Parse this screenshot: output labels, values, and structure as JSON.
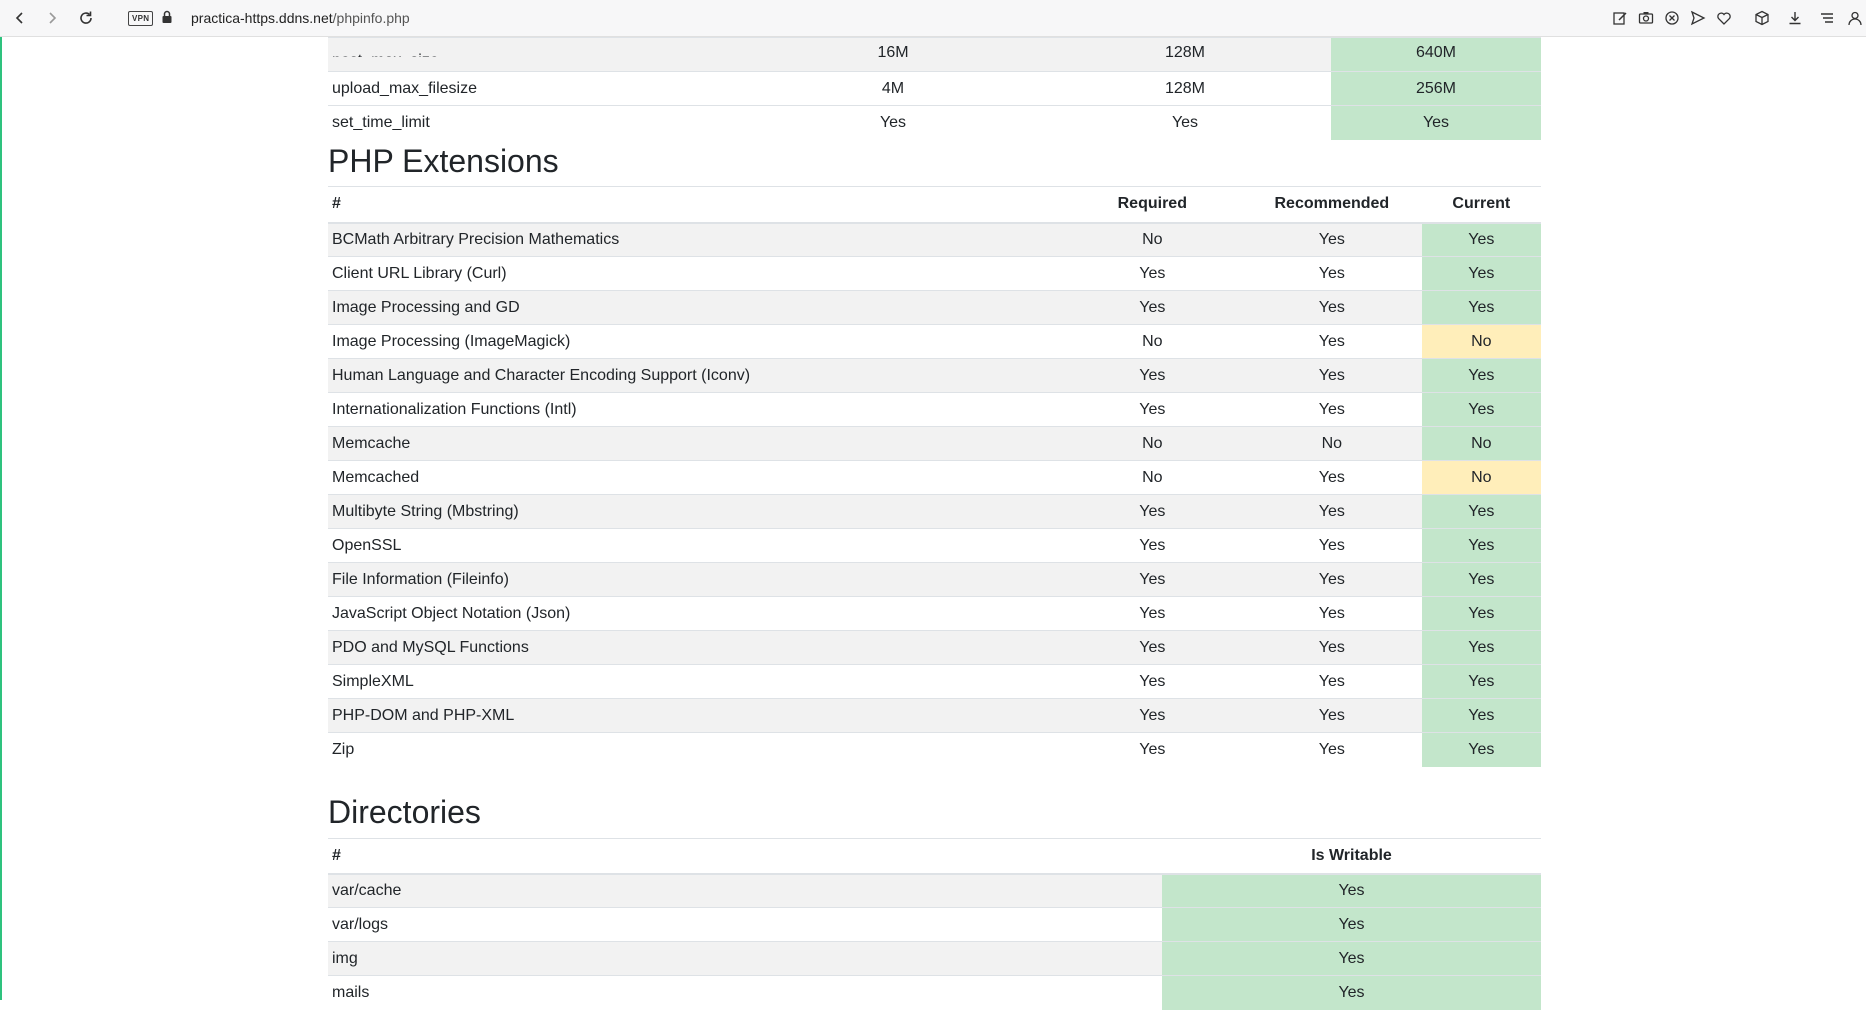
{
  "browser": {
    "url_host": "practica-https.ddns.net",
    "url_path": "/phpinfo.php",
    "vpn_label": "VPN"
  },
  "settings_rows": [
    {
      "name": "post_max_size",
      "required": "16M",
      "recommended": "128M",
      "current": "640M"
    },
    {
      "name": "upload_max_filesize",
      "required": "4M",
      "recommended": "128M",
      "current": "256M"
    },
    {
      "name": "set_time_limit",
      "required": "Yes",
      "recommended": "Yes",
      "current": "Yes"
    }
  ],
  "extensions": {
    "title": "PHP Extensions",
    "headers": {
      "name": "#",
      "required": "Required",
      "recommended": "Recommended",
      "current": "Current"
    },
    "rows": [
      {
        "name": "BCMath Arbitrary Precision Mathematics",
        "required": "No",
        "recommended": "Yes",
        "current": "Yes"
      },
      {
        "name": "Client URL Library (Curl)",
        "required": "Yes",
        "recommended": "Yes",
        "current": "Yes"
      },
      {
        "name": "Image Processing and GD",
        "required": "Yes",
        "recommended": "Yes",
        "current": "Yes"
      },
      {
        "name": "Image Processing (ImageMagick)",
        "required": "No",
        "recommended": "Yes",
        "current": "No"
      },
      {
        "name": "Human Language and Character Encoding Support (Iconv)",
        "required": "Yes",
        "recommended": "Yes",
        "current": "Yes"
      },
      {
        "name": "Internationalization Functions (Intl)",
        "required": "Yes",
        "recommended": "Yes",
        "current": "Yes"
      },
      {
        "name": "Memcache",
        "required": "No",
        "recommended": "No",
        "current": "No"
      },
      {
        "name": "Memcached",
        "required": "No",
        "recommended": "Yes",
        "current": "No"
      },
      {
        "name": "Multibyte String (Mbstring)",
        "required": "Yes",
        "recommended": "Yes",
        "current": "Yes"
      },
      {
        "name": "OpenSSL",
        "required": "Yes",
        "recommended": "Yes",
        "current": "Yes"
      },
      {
        "name": "File Information (Fileinfo)",
        "required": "Yes",
        "recommended": "Yes",
        "current": "Yes"
      },
      {
        "name": "JavaScript Object Notation (Json)",
        "required": "Yes",
        "recommended": "Yes",
        "current": "Yes"
      },
      {
        "name": "PDO and MySQL Functions",
        "required": "Yes",
        "recommended": "Yes",
        "current": "Yes"
      },
      {
        "name": "SimpleXML",
        "required": "Yes",
        "recommended": "Yes",
        "current": "Yes"
      },
      {
        "name": "PHP-DOM and PHP-XML",
        "required": "Yes",
        "recommended": "Yes",
        "current": "Yes"
      },
      {
        "name": "Zip",
        "required": "Yes",
        "recommended": "Yes",
        "current": "Yes"
      }
    ]
  },
  "directories": {
    "title": "Directories",
    "headers": {
      "name": "#",
      "writable": "Is Writable"
    },
    "rows": [
      {
        "name": "var/cache",
        "writable": "Yes"
      },
      {
        "name": "var/logs",
        "writable": "Yes"
      },
      {
        "name": "img",
        "writable": "Yes"
      },
      {
        "name": "mails",
        "writable": "Yes"
      }
    ]
  },
  "colors": {
    "ok": "#c3e6cb",
    "warn": "#ffeeba",
    "stripe": "#f2f2f2",
    "accent": "#2ec27e"
  },
  "icons": {
    "toolbar": [
      "back-icon",
      "forward-icon",
      "reload-icon",
      "vpn-icon",
      "lock-icon",
      "snapshot-edit-icon",
      "camera-icon",
      "block-icon",
      "send-icon",
      "heart-icon",
      "cube-icon",
      "download-icon",
      "menu-icon",
      "profile-icon"
    ]
  }
}
